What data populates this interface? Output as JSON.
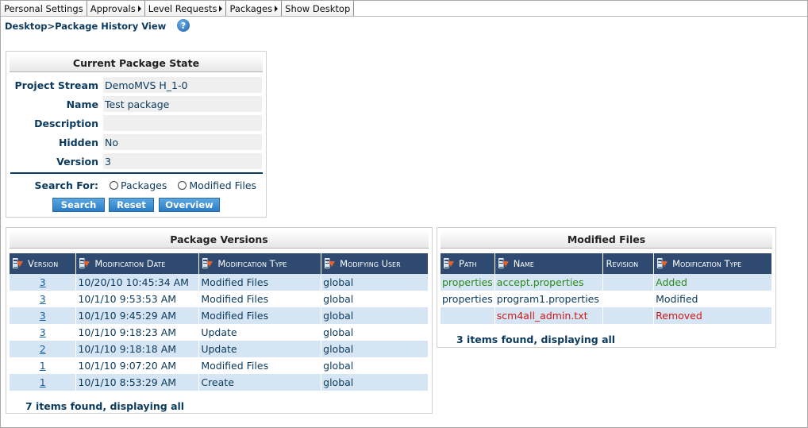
{
  "menu": {
    "items": [
      {
        "label": "Personal Settings",
        "has_arrow": false
      },
      {
        "label": "Approvals",
        "has_arrow": true
      },
      {
        "label": "Level Requests",
        "has_arrow": true
      },
      {
        "label": "Packages",
        "has_arrow": true
      },
      {
        "label": "Show Desktop",
        "has_arrow": false
      }
    ]
  },
  "breadcrumb": {
    "text": "Desktop>Package History View",
    "help_icon": "?"
  },
  "state_panel": {
    "title": "Current Package State",
    "fields": [
      {
        "label": "Project Stream",
        "value": "DemoMVS H_1-0"
      },
      {
        "label": "Name",
        "value": "Test package"
      },
      {
        "label": "Description",
        "value": ""
      },
      {
        "label": "Hidden",
        "value": "No"
      },
      {
        "label": "Version",
        "value": "3"
      }
    ],
    "search_for_label": "Search For:",
    "search_options": [
      "Packages",
      "Modified Files"
    ],
    "buttons": {
      "search": "Search",
      "reset": "Reset",
      "overview": "Overview"
    }
  },
  "versions_panel": {
    "title": "Package Versions",
    "columns": [
      "Version",
      "Modification Date",
      "Modification Type",
      "Modifying User"
    ],
    "rows": [
      {
        "version": "3",
        "date": "10/20/10 10:45:34 AM",
        "type": "Modified Files",
        "user": "global"
      },
      {
        "version": "3",
        "date": "10/1/10 9:53:53 AM",
        "type": "Modified Files",
        "user": "global"
      },
      {
        "version": "3",
        "date": "10/1/10 9:45:29 AM",
        "type": "Modified Files",
        "user": "global"
      },
      {
        "version": "3",
        "date": "10/1/10 9:18:23 AM",
        "type": "Update",
        "user": "global"
      },
      {
        "version": "2",
        "date": "10/1/10 9:18:18 AM",
        "type": "Update",
        "user": "global"
      },
      {
        "version": "1",
        "date": "10/1/10 9:07:20 AM",
        "type": "Modified Files",
        "user": "global"
      },
      {
        "version": "1",
        "date": "10/1/10 8:53:29 AM",
        "type": "Create",
        "user": "global"
      }
    ],
    "found_text": "7 items found, displaying all"
  },
  "files_panel": {
    "title": "Modified Files",
    "columns": [
      "Path",
      "Name",
      "Revision",
      "Modification Type"
    ],
    "rows": [
      {
        "path": "properties",
        "name": "accept.properties",
        "revision": "",
        "type": "Added",
        "status_color": "#2b8a1e"
      },
      {
        "path": "properties",
        "name": "program1.properties",
        "revision": "",
        "type": "Modified",
        "status_color": "#0b3a5e"
      },
      {
        "path": "",
        "name": "scm4all_admin.txt",
        "revision": "",
        "type": "Removed",
        "status_color": "#d01818"
      }
    ],
    "found_text": "3 items found, displaying all"
  },
  "colors": {
    "header_bg": "#2e4a70",
    "alt_row_bg": "#d6e5f3",
    "text_navy": "#0b3a5e",
    "button_blue": "#2b7cc6"
  }
}
